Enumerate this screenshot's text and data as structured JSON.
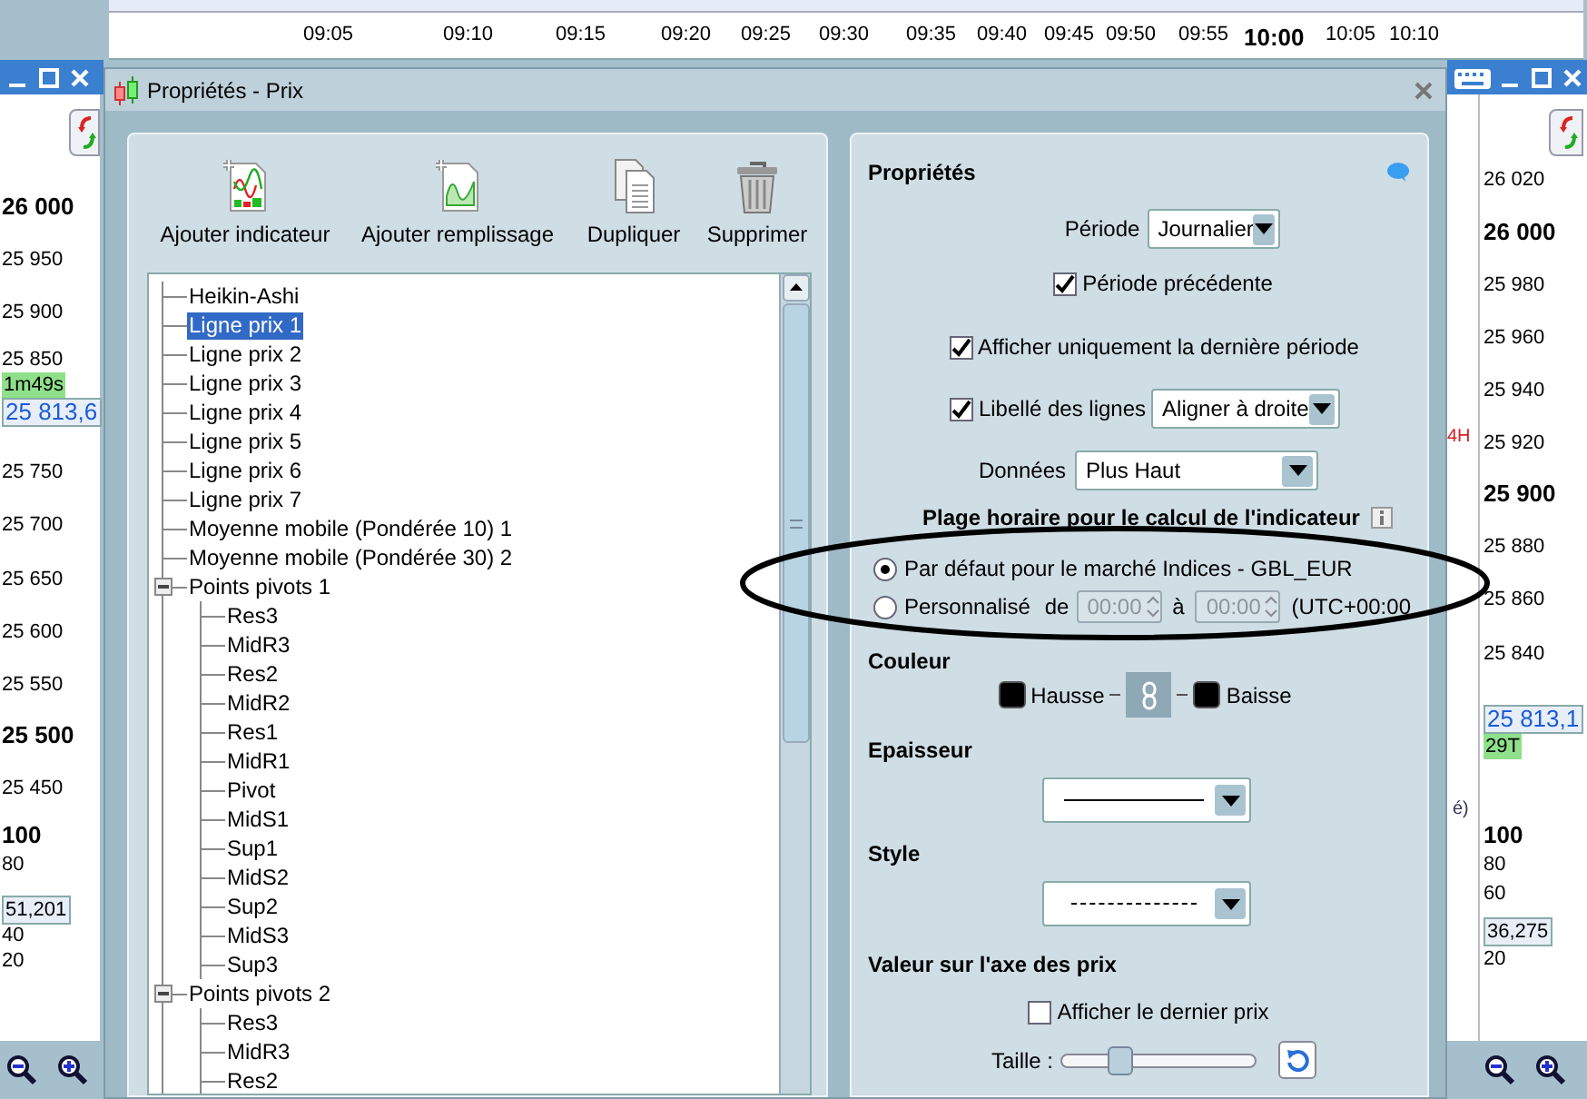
{
  "time_axis": {
    "ticks": [
      {
        "label": "09:05",
        "major": false
      },
      {
        "label": "09:10",
        "major": false
      },
      {
        "label": "09:15",
        "major": false
      },
      {
        "label": "09:20",
        "major": false
      },
      {
        "label": "09:25",
        "major": false
      },
      {
        "label": "09:30",
        "major": false
      },
      {
        "label": "09:35",
        "major": false
      },
      {
        "label": "09:40",
        "major": false
      },
      {
        "label": "09:45",
        "major": false
      },
      {
        "label": "09:50",
        "major": false
      },
      {
        "label": "09:55",
        "major": false
      },
      {
        "label": "10:00",
        "major": true
      },
      {
        "label": "10:05",
        "major": false
      },
      {
        "label": "10:10",
        "major": false
      }
    ]
  },
  "left_chart": {
    "axis_labels": [
      {
        "text": "26 000",
        "kind": "major"
      },
      {
        "text": "25 950",
        "kind": "minor"
      },
      {
        "text": "25 900",
        "kind": "minor"
      },
      {
        "text": "25 850",
        "kind": "minor"
      },
      {
        "text": "1m49s",
        "kind": "timer"
      },
      {
        "text": "25 813,6",
        "kind": "price"
      },
      {
        "text": "25 750",
        "kind": "minor"
      },
      {
        "text": "25 700",
        "kind": "minor"
      },
      {
        "text": "25 650",
        "kind": "minor"
      },
      {
        "text": "25 600",
        "kind": "minor"
      },
      {
        "text": "25 550",
        "kind": "minor"
      },
      {
        "text": "25 500",
        "kind": "major"
      },
      {
        "text": "25 450",
        "kind": "minor"
      },
      {
        "text": "100",
        "kind": "major"
      },
      {
        "text": "80",
        "kind": "minor"
      },
      {
        "text": "51,201",
        "kind": "value"
      },
      {
        "text": "40",
        "kind": "minor"
      },
      {
        "text": "20",
        "kind": "minor"
      }
    ]
  },
  "right_chart": {
    "axis_labels": [
      {
        "text": "26 020",
        "kind": "minor"
      },
      {
        "text": "26 000",
        "kind": "major"
      },
      {
        "text": "25 980",
        "kind": "minor"
      },
      {
        "text": "25 960",
        "kind": "minor"
      },
      {
        "text": "25 940",
        "kind": "minor"
      },
      {
        "text": "25 920",
        "kind": "minor"
      },
      {
        "text": "25 900",
        "kind": "major"
      },
      {
        "text": "25 880",
        "kind": "minor"
      },
      {
        "text": "25 860",
        "kind": "minor"
      },
      {
        "text": "25 840",
        "kind": "minor"
      },
      {
        "text": "25 813,1",
        "kind": "price"
      },
      {
        "text": "29T",
        "kind": "timer"
      },
      {
        "text": "100",
        "kind": "major"
      },
      {
        "text": "80",
        "kind": "minor"
      },
      {
        "text": "60",
        "kind": "minor"
      },
      {
        "text": "36,275",
        "kind": "value"
      },
      {
        "text": "20",
        "kind": "minor"
      }
    ],
    "line_labels": [
      {
        "text": "4H",
        "kind": "alert"
      },
      {
        "text": "é)",
        "kind": "plain"
      }
    ]
  },
  "dialog": {
    "title": "Propriétés - Prix",
    "toolbar": [
      {
        "label": "Ajouter indicateur",
        "kind": "indicator"
      },
      {
        "label": "Ajouter remplissage",
        "kind": "fill"
      },
      {
        "label": "Dupliquer",
        "kind": "duplicate"
      },
      {
        "label": "Supprimer",
        "kind": "delete"
      }
    ],
    "tree": [
      {
        "label": "Heikin-Ashi",
        "selected": false
      },
      {
        "label": "Ligne prix 1",
        "selected": true
      },
      {
        "label": "Ligne prix 2",
        "selected": false
      },
      {
        "label": "Ligne prix 3",
        "selected": false
      },
      {
        "label": "Ligne prix 4",
        "selected": false
      },
      {
        "label": "Ligne prix 5",
        "selected": false
      },
      {
        "label": "Ligne prix 6",
        "selected": false
      },
      {
        "label": "Ligne prix 7",
        "selected": false
      },
      {
        "label": "Moyenne mobile (Pondérée 10) 1",
        "selected": false
      },
      {
        "label": "Moyenne mobile (Pondérée 30) 2",
        "selected": false
      },
      {
        "label": "Points pivots 1",
        "selected": false,
        "expanded": true,
        "children": [
          {
            "label": "Res3",
            "selected": false
          },
          {
            "label": "MidR3",
            "selected": false
          },
          {
            "label": "Res2",
            "selected": false
          },
          {
            "label": "MidR2",
            "selected": false
          },
          {
            "label": "Res1",
            "selected": false
          },
          {
            "label": "MidR1",
            "selected": false
          },
          {
            "label": "Pivot",
            "selected": false
          },
          {
            "label": "MidS1",
            "selected": false
          },
          {
            "label": "Sup1",
            "selected": false
          },
          {
            "label": "MidS2",
            "selected": false
          },
          {
            "label": "Sup2",
            "selected": false
          },
          {
            "label": "MidS3",
            "selected": false
          },
          {
            "label": "Sup3",
            "selected": false
          }
        ]
      },
      {
        "label": "Points pivots 2",
        "selected": false,
        "expanded": true,
        "children": [
          {
            "label": "Res3",
            "selected": false
          },
          {
            "label": "MidR3",
            "selected": false
          },
          {
            "label": "Res2",
            "selected": false
          }
        ]
      }
    ],
    "properties": {
      "heading": "Propriétés",
      "period": {
        "label": "Période",
        "value": "Journalier"
      },
      "previous_period": {
        "label": "Période précédente",
        "checked": true
      },
      "last_period_only": {
        "label": "Afficher uniquement la dernière période",
        "checked": true
      },
      "line_labels": {
        "label": "Libellé des lignes",
        "checked": true,
        "value": "Aligner à droite"
      },
      "data": {
        "label": "Données",
        "value": "Plus Haut"
      },
      "time_range": {
        "heading": "Plage horaire pour le calcul de l'indicateur",
        "options": [
          {
            "label": "Par défaut pour le marché Indices - GBL_EUR",
            "selected": true
          },
          {
            "label": "Personnalisé",
            "selected": false
          }
        ],
        "from_label": "de",
        "from": "00:00",
        "to_label": "à",
        "to": "00:00",
        "disabled": true,
        "timezone": "(UTC+00:00"
      },
      "color": {
        "heading": "Couleur",
        "up_label": "Hausse",
        "down_label": "Baisse",
        "linked": true
      },
      "thickness": {
        "heading": "Epaisseur"
      },
      "style": {
        "heading": "Style"
      },
      "price_axis": {
        "heading": "Valeur sur l'axe des prix",
        "show_last_price": {
          "label": "Afficher le dernier prix",
          "checked": false
        },
        "size": {
          "label": "Taille :",
          "level": 0.3
        }
      }
    }
  }
}
